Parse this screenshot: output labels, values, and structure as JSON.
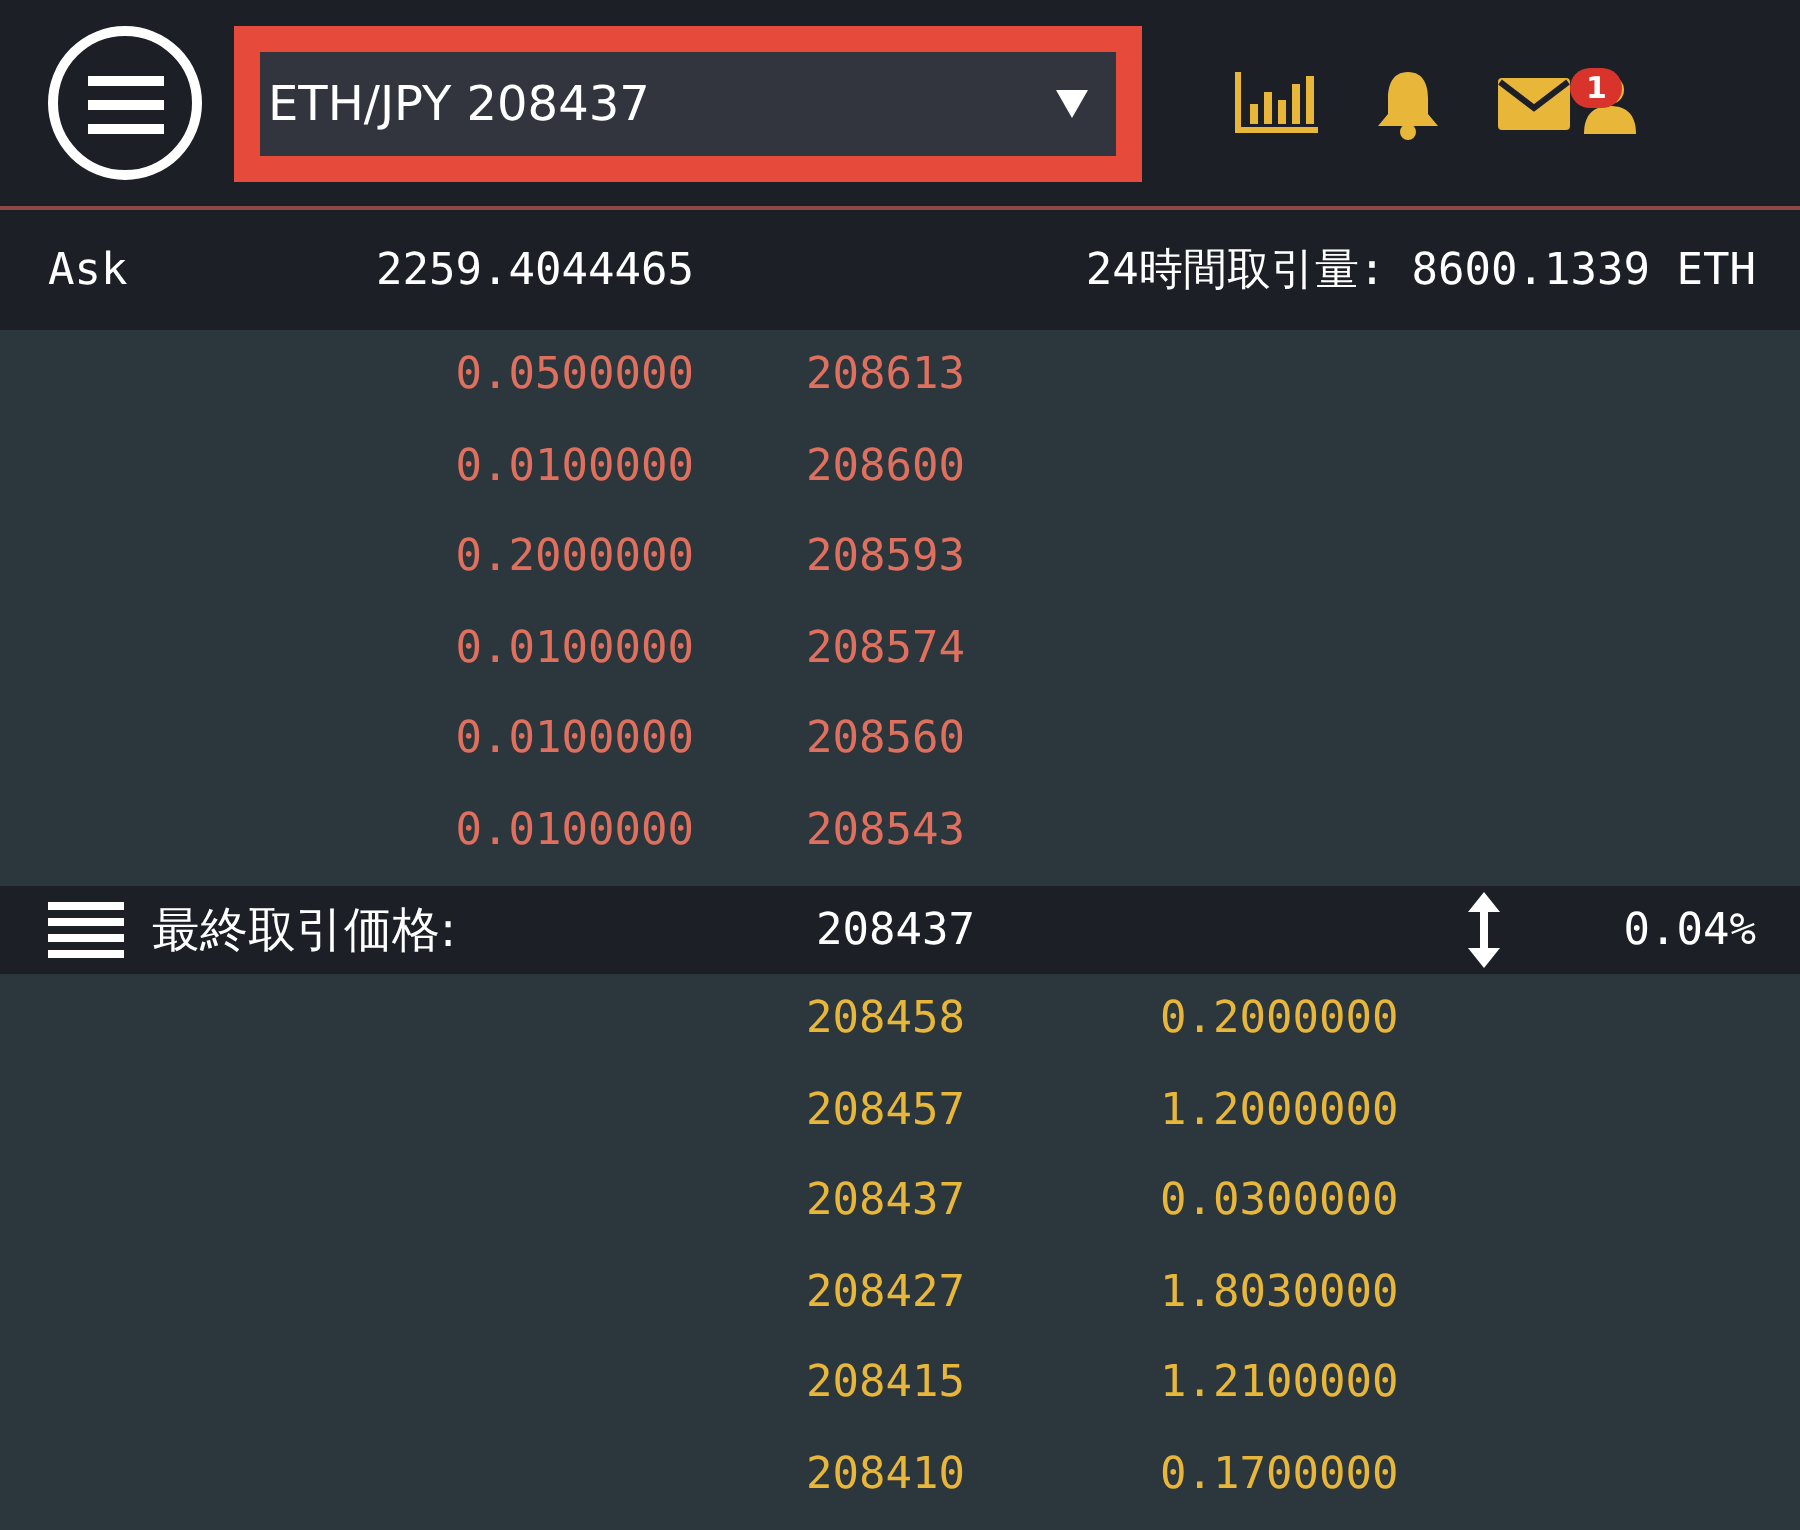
{
  "header": {
    "pair_select": {
      "value": "ETH/JPY 208437"
    },
    "mail_badge": "1"
  },
  "ticker": {
    "label": "Ask",
    "value": "2259.4044465",
    "volume": "24時間取引量: 8600.1339 ETH"
  },
  "asks": [
    {
      "amount": "0.0500000",
      "price": "208613"
    },
    {
      "amount": "0.0100000",
      "price": "208600"
    },
    {
      "amount": "0.2000000",
      "price": "208593"
    },
    {
      "amount": "0.0100000",
      "price": "208574"
    },
    {
      "amount": "0.0100000",
      "price": "208560"
    },
    {
      "amount": "0.0100000",
      "price": "208543"
    }
  ],
  "last_trade": {
    "label": "最終取引価格:",
    "price": "208437",
    "change": "0.04%"
  },
  "bids": [
    {
      "price": "208458",
      "amount": "0.2000000"
    },
    {
      "price": "208457",
      "amount": "1.2000000"
    },
    {
      "price": "208437",
      "amount": "0.0300000"
    },
    {
      "price": "208427",
      "amount": "1.8030000"
    },
    {
      "price": "208415",
      "amount": "1.2100000"
    },
    {
      "price": "208410",
      "amount": "0.1700000"
    }
  ]
}
